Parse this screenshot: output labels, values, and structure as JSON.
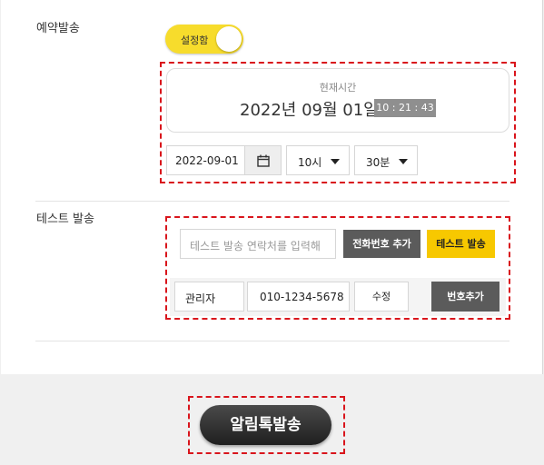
{
  "reservation": {
    "label": "예약발송",
    "toggle_label": "설정함",
    "toggle_on": true,
    "time_caption": "현재시간",
    "current_date": "2022년 09월 01일",
    "current_time": "10 : 21 : 43",
    "date_value": "2022-09-01",
    "hour_value": "10시",
    "minute_value": "30분"
  },
  "test_send": {
    "label": "테스트 발송",
    "phone_placeholder": "테스트 발송 연락처를 입력해",
    "add_phone_button": "전화번호 추가",
    "test_send_button": "테스트 발송",
    "row": {
      "name": "관리자",
      "phone": "010-1234-5678",
      "edit_button": "수정",
      "add_number_button": "번호추가"
    }
  },
  "footer": {
    "send_button": "알림톡발송"
  },
  "colors": {
    "accent_yellow": "#f7c800",
    "toggle_yellow": "#f7dc2c",
    "highlight_dash": "#d9151c",
    "dark_button": "#5b5b5b"
  },
  "icons": {
    "calendar": "calendar-icon",
    "dropdown": "caret-down-icon"
  }
}
